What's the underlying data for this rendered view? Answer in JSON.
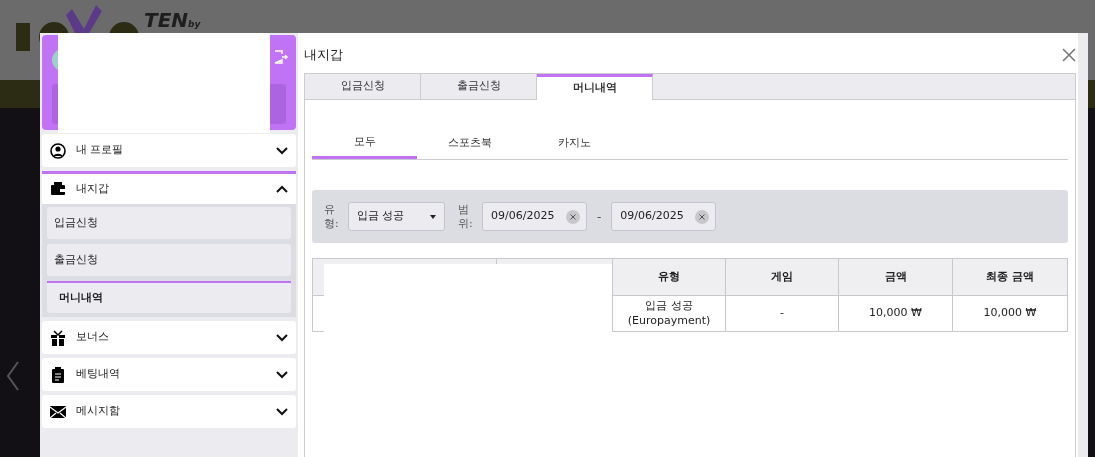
{
  "background": {
    "logo_word": "TEN",
    "logo_by": "by"
  },
  "sidebar": {
    "items": [
      {
        "label": "내 프로필",
        "selected": false,
        "expanded": false
      },
      {
        "label": "내지갑",
        "selected": true,
        "expanded": true,
        "children": [
          {
            "label": "입금신청",
            "selected": false
          },
          {
            "label": "출금신청",
            "selected": false
          },
          {
            "label": "머니내역",
            "selected": true
          }
        ]
      },
      {
        "label": "보너스",
        "selected": false,
        "expanded": false
      },
      {
        "label": "베팅내역",
        "selected": false,
        "expanded": false
      },
      {
        "label": "메시지함",
        "selected": false,
        "expanded": false
      }
    ]
  },
  "modal": {
    "title": "내지갑",
    "tabs": [
      {
        "label": "입금신청",
        "selected": false
      },
      {
        "label": "출금신청",
        "selected": false
      },
      {
        "label": "머니내역",
        "selected": true
      }
    ],
    "subtabs": [
      {
        "label": "모두",
        "selected": true
      },
      {
        "label": "스포츠북",
        "selected": false
      },
      {
        "label": "카지노",
        "selected": false
      }
    ],
    "filter": {
      "type_label": "유형:",
      "type_value": "입금 성공",
      "range_label": "범위:",
      "date_from": "09/06/2025",
      "separator": "-",
      "date_to": "09/06/2025"
    },
    "table": {
      "columns": [
        "유형",
        "게임",
        "금액",
        "최종 금액"
      ],
      "rows": [
        {
          "cells": [
            "입금 성공 (Europayment)",
            "-",
            "10,000 ₩",
            "10,000 ₩"
          ]
        }
      ]
    }
  }
}
